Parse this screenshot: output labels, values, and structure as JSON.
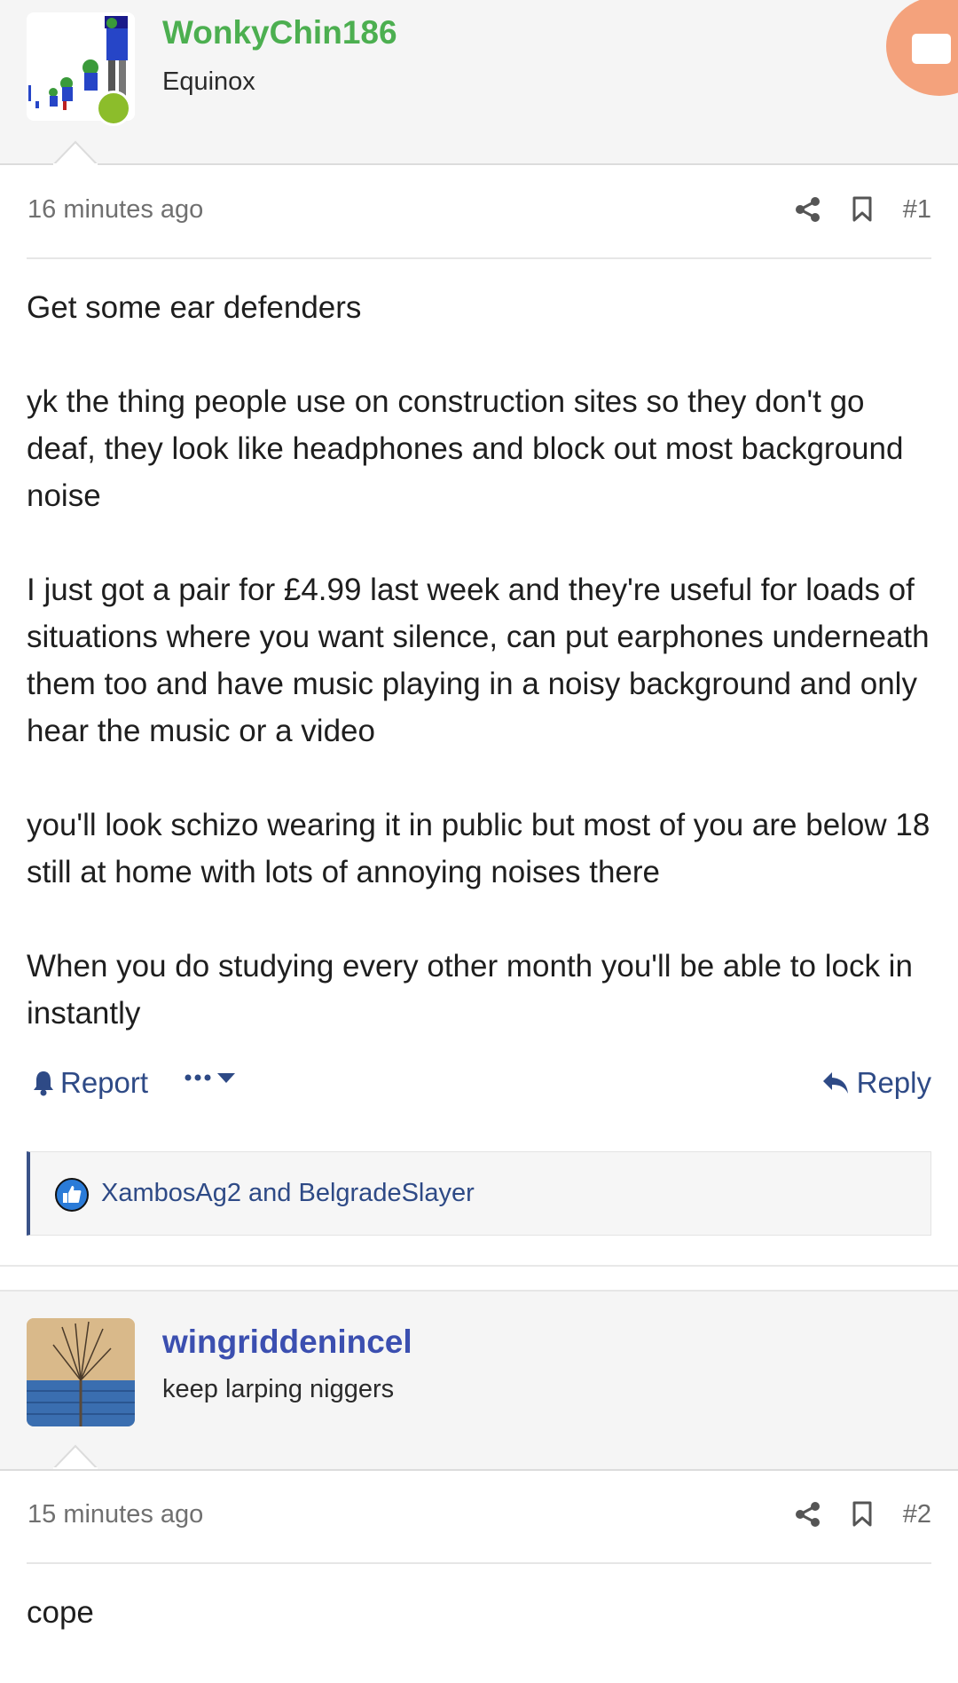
{
  "posts": [
    {
      "author": "WonkyChin186",
      "author_color": "#4caf50",
      "user_title": "Equinox",
      "time": "16 minutes ago",
      "number": "#1",
      "body": [
        "Get some ear defenders",
        "yk the thing people use on construction sites so they don't go deaf, they look like headphones and block out most background noise",
        "I just got a pair for £4.99 last week and they're useful for loads of situations where you want silence, can put earphones underneath them too and have music playing in a noisy background and only hear the music or a video",
        "you'll look schizo wearing it in public but most of you are below 18 still at home with lots of annoying noises there",
        "When you do studying every other month you'll be able to lock in instantly"
      ],
      "report_label": "Report",
      "reply_label": "Reply",
      "reactions": "XambosAg2 and BelgradeSlayer"
    },
    {
      "author": "wingriddenincel",
      "author_color": "#3b4fb0",
      "user_title": "keep larping niggers",
      "time": "15 minutes ago",
      "number": "#2",
      "body": [
        "cope"
      ]
    }
  ],
  "colors": {
    "link": "#2e4a86",
    "online": "#8cbd2b",
    "fab": "#f4a27c"
  },
  "icons": [
    "share-icon",
    "bookmark-icon",
    "bell-icon",
    "ellipsis-icon",
    "caret-down-icon",
    "reply-icon",
    "like-icon",
    "video-icon"
  ]
}
